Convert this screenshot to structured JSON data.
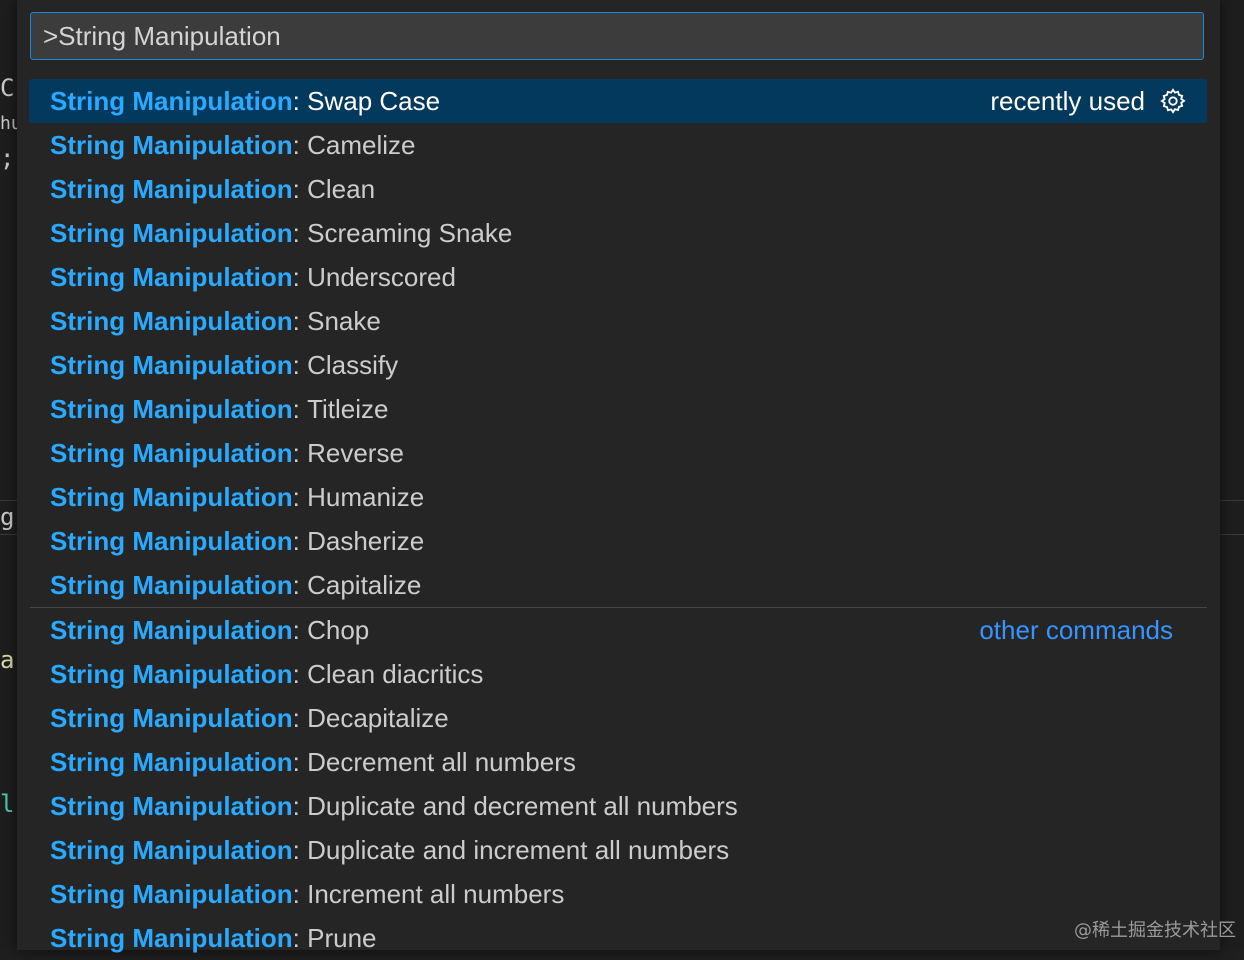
{
  "editor": {
    "glyphs": [
      "C",
      "hu",
      ";",
      "g",
      "a",
      "l"
    ]
  },
  "palette": {
    "input_value": ">String Manipulation",
    "prefix": "String Manipulation",
    "separator": ": ",
    "recently_used_label": "recently used",
    "other_commands_label": "other commands",
    "recent_items": [
      "Swap Case",
      "Camelize",
      "Clean",
      "Screaming Snake",
      "Underscored",
      "Snake",
      "Classify",
      "Titleize",
      "Reverse",
      "Humanize",
      "Dasherize",
      "Capitalize"
    ],
    "other_items": [
      "Chop",
      "Clean diacritics",
      "Decapitalize",
      "Decrement all numbers",
      "Duplicate and decrement all numbers",
      "Duplicate and increment all numbers",
      "Increment all numbers",
      "Prune"
    ],
    "selected_index": 0
  },
  "watermark": "@稀土掘金技术社区",
  "colors": {
    "selection_bg": "#04395e",
    "accent": "#1a8ad6",
    "highlight_text": "#2aaaff",
    "link": "#3794ff"
  }
}
